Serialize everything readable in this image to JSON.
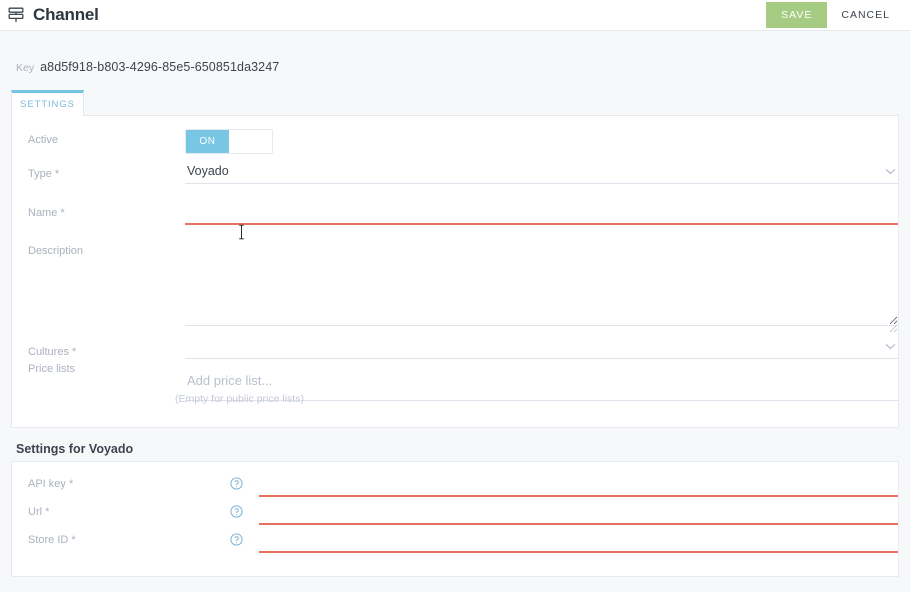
{
  "topbar": {
    "icon": "channel-signpost-icon",
    "title": "Channel",
    "save_label": "SAVE",
    "cancel_label": "CANCEL",
    "save_color": "#a5cc82"
  },
  "key_row": {
    "label": "Key",
    "value": "a8d5f918-b803-4296-85e5-650851da3247"
  },
  "tabs": [
    {
      "label": "SETTINGS",
      "active": true,
      "accent": "#74c4e8"
    }
  ],
  "settings": {
    "active": {
      "label": "Active",
      "state_label": "ON",
      "on_color": "#79c6e4"
    },
    "type": {
      "label": "Type *",
      "value": "Voyado",
      "chevron": "chevron-down-icon"
    },
    "name": {
      "label": "Name *",
      "value": "",
      "placeholder": "",
      "error": true
    },
    "description": {
      "label": "Description",
      "value": "",
      "placeholder": ""
    },
    "cultures": {
      "label": "Cultures *",
      "value": "",
      "chevron": "chevron-down-icon"
    },
    "price_lists": {
      "label": "Price lists",
      "value": "",
      "placeholder": "Add price list...",
      "hint": "(Empty for public price lists)"
    }
  },
  "voyado_section": {
    "heading": "Settings for Voyado",
    "error_color": "#e8705f",
    "fields": [
      {
        "label": "API key *",
        "value": "",
        "help": "help-icon",
        "error": true
      },
      {
        "label": "Url *",
        "value": "",
        "help": "help-icon",
        "error": true
      },
      {
        "label": "Store ID *",
        "value": "",
        "help": "help-icon",
        "error": true
      }
    ]
  }
}
